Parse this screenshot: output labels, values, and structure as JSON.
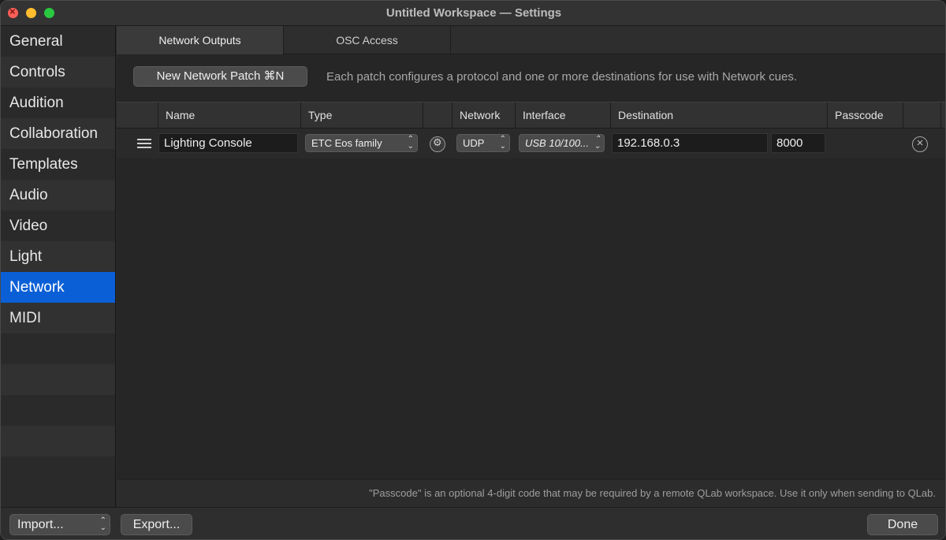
{
  "window": {
    "title": "Untitled Workspace — Settings"
  },
  "sidebar": {
    "items": [
      {
        "label": "General"
      },
      {
        "label": "Controls"
      },
      {
        "label": "Audition"
      },
      {
        "label": "Collaboration"
      },
      {
        "label": "Templates"
      },
      {
        "label": "Audio"
      },
      {
        "label": "Video"
      },
      {
        "label": "Light"
      },
      {
        "label": "Network",
        "selected": true
      },
      {
        "label": "MIDI"
      }
    ]
  },
  "tabs": [
    {
      "label": "Network Outputs",
      "selected": true
    },
    {
      "label": "OSC Access"
    }
  ],
  "toolbar": {
    "new_patch_label": "New Network Patch ⌘N",
    "hint": "Each patch configures a protocol and one or more destinations for use with Network cues."
  },
  "table": {
    "columns": [
      "Name",
      "Type",
      "Network",
      "Interface",
      "Destination",
      "Passcode"
    ],
    "rows": [
      {
        "name": "Lighting Console",
        "type": "ETC Eos family",
        "network": "UDP",
        "interface": "USB 10/100...",
        "destination": "192.168.0.3",
        "port": "8000",
        "passcode": ""
      }
    ]
  },
  "footnote": "\"Passcode\" is an optional 4-digit code that may be required by a remote QLab workspace. Use it only when sending to QLab.",
  "bottom": {
    "import_label": "Import...",
    "export_label": "Export...",
    "done_label": "Done"
  },
  "colors": {
    "accent": "#0a5fd6"
  },
  "icons": {
    "close": "close-icon",
    "drag": "drag-handle-icon",
    "settings": "settings-icon",
    "delete": "delete-icon"
  }
}
